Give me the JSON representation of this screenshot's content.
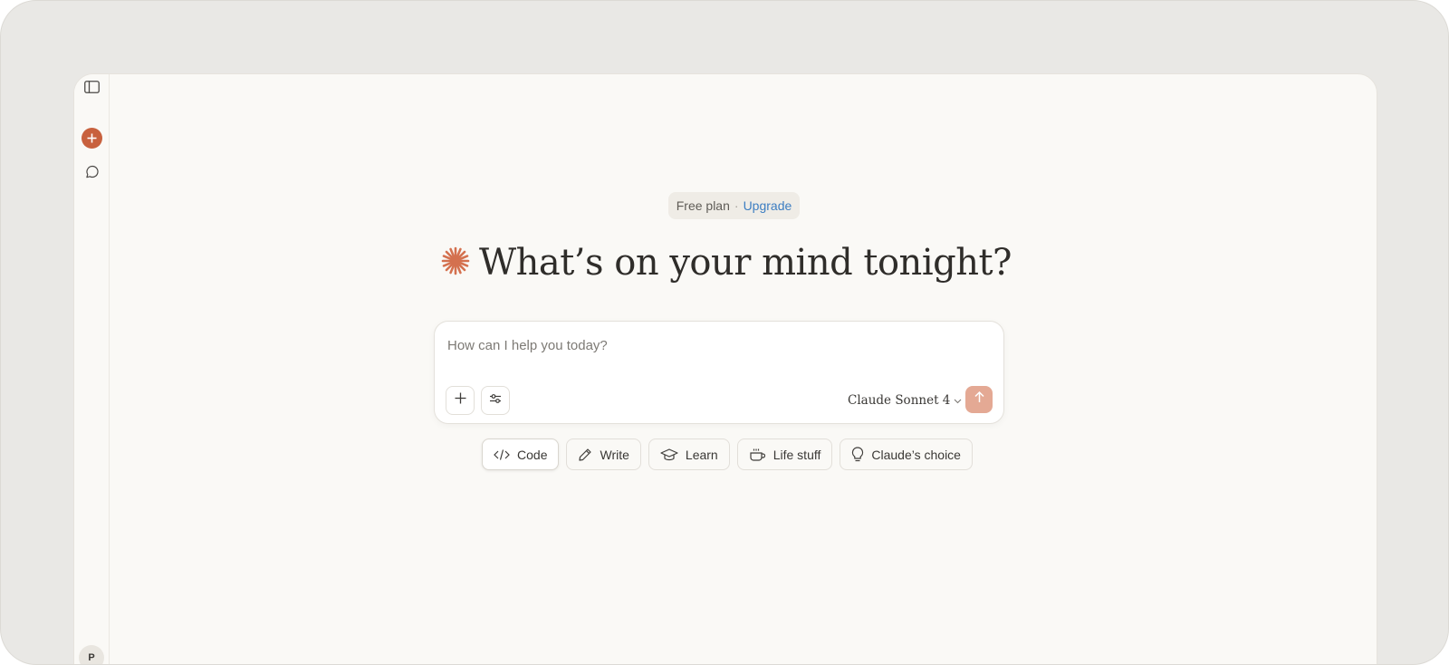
{
  "sidebar": {
    "toggle_icon": "sidebar-toggle-icon",
    "new_chat_icon": "plus-icon",
    "chats_icon": "chat-bubble-icon",
    "avatar_initial": "P"
  },
  "plan": {
    "label": "Free plan",
    "separator": "·",
    "upgrade_label": "Upgrade"
  },
  "greeting": {
    "text": "What’s on your mind tonight?",
    "icon": "claude-spark-icon",
    "icon_color": "#d4714f"
  },
  "composer": {
    "placeholder": "How can I help you today?",
    "value": "",
    "add_icon": "plus-icon",
    "tools_icon": "sliders-icon",
    "model_label": "Claude Sonnet 4",
    "model_dropdown_icon": "chevron-down-icon",
    "send_icon": "arrow-up-icon",
    "send_color": "#e4a994"
  },
  "suggestions": [
    {
      "label": "Code",
      "icon": "code-icon",
      "active": true
    },
    {
      "label": "Write",
      "icon": "pencil-icon",
      "active": false
    },
    {
      "label": "Learn",
      "icon": "graduation-cap-icon",
      "active": false
    },
    {
      "label": "Life stuff",
      "icon": "coffee-cup-icon",
      "active": false
    },
    {
      "label": "Claude’s choice",
      "icon": "lightbulb-icon",
      "active": false
    }
  ],
  "colors": {
    "accent": "#c8613e",
    "background": "#faf9f6",
    "link": "#3d7ec2"
  }
}
